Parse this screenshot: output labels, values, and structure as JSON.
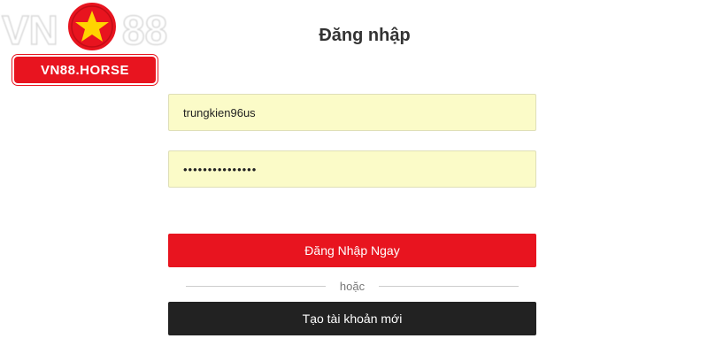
{
  "logo": {
    "wordmark_left": "VN",
    "wordmark_right": "88",
    "badge_text": "VN88.HORSE",
    "colors": {
      "red": "#e8141f",
      "star": "#ffd400"
    }
  },
  "form": {
    "title": "Đăng nhập",
    "username": {
      "value": "trungkien96us"
    },
    "password": {
      "value": "•••••••••••••••"
    },
    "login_label": "Đăng Nhập Ngay",
    "divider_label": "hoặc",
    "register_label": "Tạo tài khoản mới"
  },
  "colors": {
    "input_bg": "#fbfbc8",
    "primary": "#e8141f",
    "secondary": "#222222"
  }
}
